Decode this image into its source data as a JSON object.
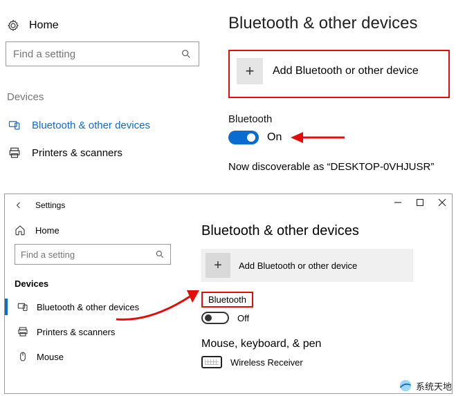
{
  "pane1": {
    "home": "Home",
    "search_placeholder": "Find a setting",
    "section": "Devices",
    "nav": [
      {
        "label": "Bluetooth & other devices"
      },
      {
        "label": "Printers & scanners"
      }
    ],
    "heading": "Bluetooth & other devices",
    "add_label": "Add Bluetooth or other device",
    "bt_label": "Bluetooth",
    "toggle_state": "On",
    "discoverable": "Now discoverable as “DESKTOP-0VHJUSR”"
  },
  "pane2": {
    "app_title": "Settings",
    "home": "Home",
    "search_placeholder": "Find a setting",
    "section": "Devices",
    "nav": [
      {
        "label": "Bluetooth & other devices"
      },
      {
        "label": "Printers & scanners"
      },
      {
        "label": "Mouse"
      }
    ],
    "heading": "Bluetooth & other devices",
    "add_label": "Add Bluetooth or other device",
    "bt_label": "Bluetooth",
    "toggle_state": "Off",
    "category": "Mouse, keyboard, & pen",
    "device": "Wireless Receiver"
  },
  "watermark": "系统天地",
  "colors": {
    "accent": "#0a6cce",
    "highlight": "#e40b0b"
  }
}
